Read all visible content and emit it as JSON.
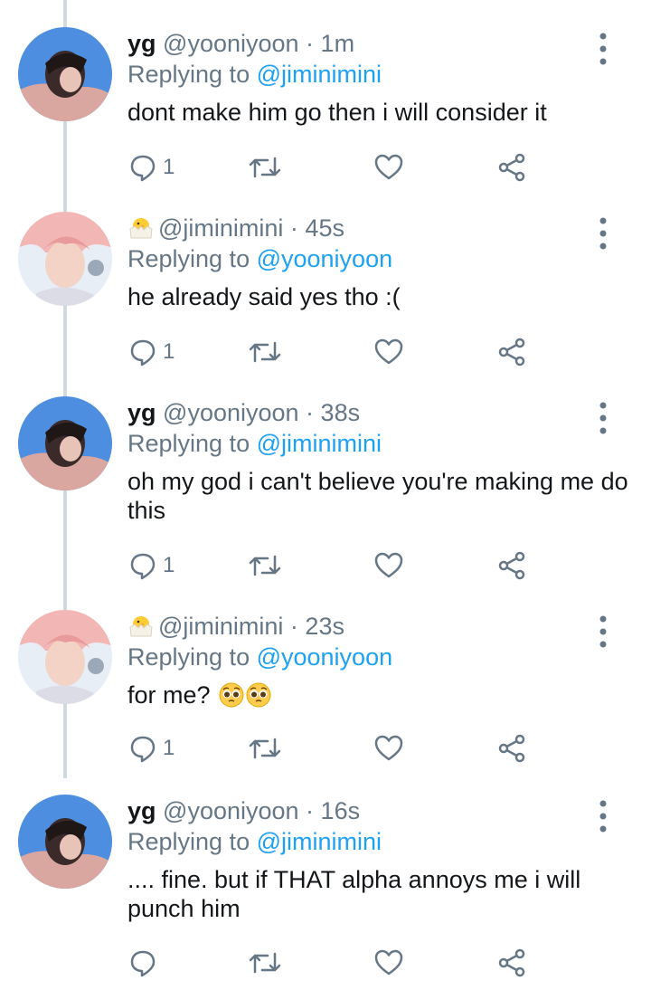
{
  "tweets": [
    {
      "name": "yg",
      "handle": "@yooniyoon",
      "time": "1m",
      "replying_label": "Replying to ",
      "replying_to": "@jiminimini",
      "text": "dont make him go then i will consider it",
      "reply_count": "1",
      "author_emoji_icon": null
    },
    {
      "name": "",
      "handle": "@jiminimini",
      "time": "45s",
      "replying_label": "Replying to ",
      "replying_to": "@yooniyoon",
      "text": "he already said yes tho :(",
      "reply_count": "1",
      "author_emoji_icon": "hatching-chick-icon"
    },
    {
      "name": "yg",
      "handle": "@yooniyoon",
      "time": "38s",
      "replying_label": "Replying to ",
      "replying_to": "@jiminimini",
      "text": "oh my god i can't believe you're making me do this",
      "reply_count": "1",
      "author_emoji_icon": null
    },
    {
      "name": "",
      "handle": "@jiminimini",
      "time": "23s",
      "replying_label": "Replying to ",
      "replying_to": "@yooniyoon",
      "text": "for me?",
      "text_emoji_icons": [
        "pleading-face-icon",
        "pleading-face-icon"
      ],
      "reply_count": "1",
      "author_emoji_icon": "hatching-chick-icon"
    },
    {
      "name": "yg",
      "handle": "@yooniyoon",
      "time": "16s",
      "replying_label": "Replying to ",
      "replying_to": "@jiminimini",
      "text": ".... fine. but if THAT alpha annoys me i will punch him",
      "reply_count": "",
      "author_emoji_icon": null
    }
  ],
  "separator": " · ",
  "colors": {
    "text": "#14171a",
    "secondary": "#657786",
    "link": "#1da1f2",
    "thread_line": "#cfd9de"
  }
}
